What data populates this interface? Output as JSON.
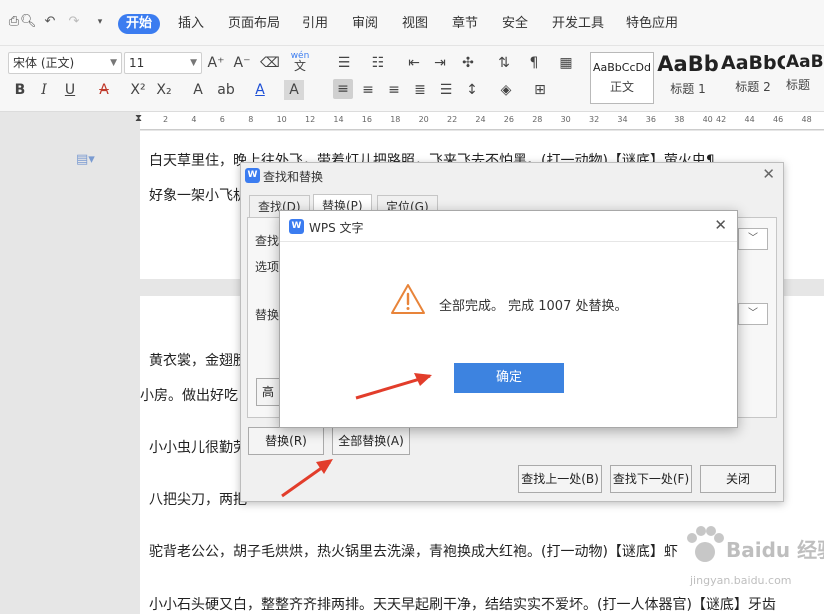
{
  "menu": {
    "tabs": [
      "开始",
      "插入",
      "页面布局",
      "引用",
      "审阅",
      "视图",
      "章节",
      "安全",
      "开发工具",
      "特色应用"
    ],
    "active_index": 0
  },
  "ribbon": {
    "font_name": "宋体 (正文)",
    "font_size": "11",
    "phonetic_label": "wén",
    "styles": [
      {
        "sample": "AaBbCcDd",
        "name": "正文"
      },
      {
        "sample": "AaBb",
        "name": "标题 1"
      },
      {
        "sample": "AaBbC",
        "name": "标题 2"
      },
      {
        "sample": "AaBl",
        "name": "标题"
      }
    ]
  },
  "ruler": {
    "ticks": [
      "2",
      "4",
      "6",
      "8",
      "10",
      "12",
      "14",
      "16",
      "18",
      "20",
      "22",
      "24",
      "26",
      "28",
      "30",
      "32",
      "34",
      "36",
      "38",
      "40",
      "42",
      "44",
      "46",
      "48"
    ]
  },
  "document": {
    "lines": [
      "白天草里住，晚上往外飞，带着灯儿把路照，飞来飞去不怕黑。(打一动物)【谜底】萤火虫¶",
      "好象一架小飞机",
      "黄衣裳，金翅膀",
      "小房。做出好吃",
      "小小虫儿很勤劳",
      "八把尖刀，两把",
      "驼背老公公，胡子毛烘烘，热火锅里去洗澡，青袍换成大红袍。(打一动物)【谜底】虾",
      "小小石头硬又白，整整齐齐排两排。天天早起刷干净，结结实实不爱坏。(打一人体器官)【谜底】牙齿"
    ]
  },
  "find_replace": {
    "title": "查找和替换",
    "tabs": [
      "查找(D)",
      "替换(P)",
      "定位(G)"
    ],
    "find_label": "查找",
    "options_label": "选项",
    "replace_label": "替换",
    "advanced_label": "高",
    "replace_button": "替换(R)",
    "replace_all_button": "全部替换(A)",
    "find_prev_button": "查找上一处(B)",
    "find_next_button": "查找下一处(F)",
    "close_button": "关闭"
  },
  "message_box": {
    "title": "WPS 文字",
    "message": "全部完成。 完成 1007 处替换。",
    "ok_button": "确定"
  },
  "watermark": {
    "brand": "Baidu 经验",
    "url": "jingyan.baidu.com"
  },
  "colors": {
    "accent": "#3b7cf0",
    "ok_button": "#3d83e0",
    "warning": "#e8843a",
    "arrow": "#e23d2b"
  }
}
